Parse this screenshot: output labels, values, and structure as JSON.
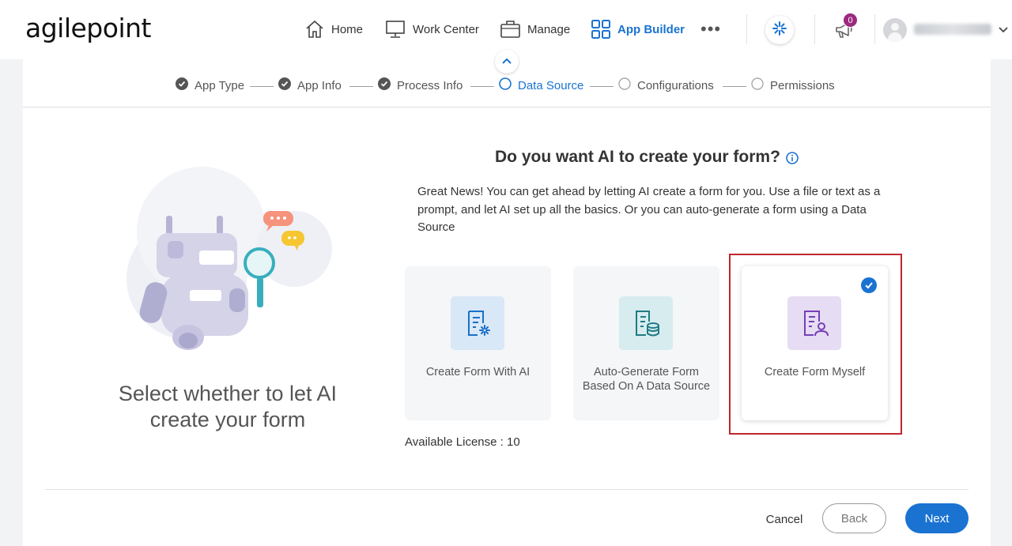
{
  "brand": {
    "logo_text": "agilepoint"
  },
  "nav": {
    "items": [
      {
        "label": "Home",
        "icon": "home-icon"
      },
      {
        "label": "Work Center",
        "icon": "monitor-icon"
      },
      {
        "label": "Manage",
        "icon": "briefcase-icon"
      },
      {
        "label": "App Builder",
        "icon": "grid-icon",
        "active": true
      }
    ],
    "more_label": "•••",
    "notification_count": "0",
    "accent_color": "#1a73d1"
  },
  "steps": [
    {
      "label": "App Type",
      "status": "done"
    },
    {
      "label": "App Info",
      "status": "done"
    },
    {
      "label": "Process Info",
      "status": "done"
    },
    {
      "label": "Data Source",
      "status": "current"
    },
    {
      "label": "Configurations",
      "status": "pending"
    },
    {
      "label": "Permissions",
      "status": "pending"
    }
  ],
  "left_panel": {
    "title": "Select whether to let AI create your form"
  },
  "main": {
    "question": "Do you want AI to create your form?",
    "description": "Great News! You can get ahead by letting AI create a form for you. Use a file or text as a prompt, and let AI set up all the basics. Or you can auto-generate a form using a Data Source",
    "options": [
      {
        "label": "Create Form With AI",
        "icon": "ai-form-icon",
        "selected": false
      },
      {
        "label": "Auto-Generate Form Based On A Data Source",
        "icon": "database-form-icon",
        "selected": false
      },
      {
        "label": "Create Form Myself",
        "icon": "user-form-icon",
        "selected": true
      }
    ],
    "license": "Available License : 10"
  },
  "footer": {
    "cancel": "Cancel",
    "back": "Back",
    "next": "Next"
  }
}
